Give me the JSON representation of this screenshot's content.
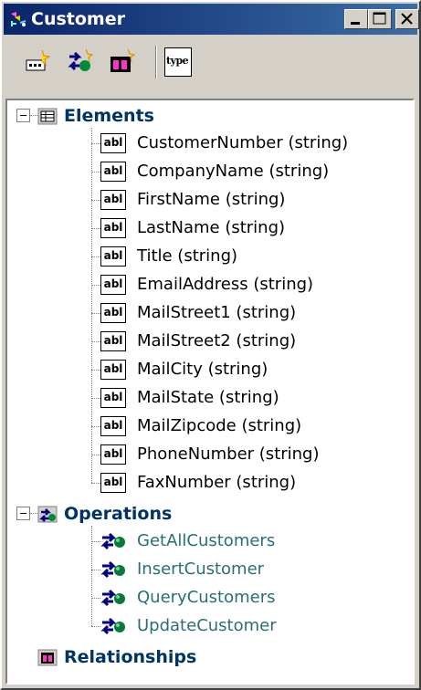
{
  "window": {
    "title": "Customer",
    "controls": [
      "minimize",
      "maximize",
      "close"
    ]
  },
  "toolbar": {
    "buttons": [
      {
        "icon": "add-element-icon"
      },
      {
        "icon": "add-operation-icon"
      },
      {
        "icon": "add-relationship-icon"
      },
      {
        "icon": "type-icon",
        "label": "type"
      }
    ]
  },
  "tree": {
    "elements": {
      "label": "Elements",
      "items": [
        {
          "badge": "abl",
          "label": "CustomerNumber (string)"
        },
        {
          "badge": "abl",
          "label": "CompanyName (string)"
        },
        {
          "badge": "abl",
          "label": "FirstName (string)"
        },
        {
          "badge": "abl",
          "label": "LastName (string)"
        },
        {
          "badge": "abl",
          "label": "Title (string)"
        },
        {
          "badge": "abl",
          "label": "EmailAddress (string)"
        },
        {
          "badge": "abl",
          "label": "MailStreet1 (string)"
        },
        {
          "badge": "abl",
          "label": "MailStreet2 (string)"
        },
        {
          "badge": "abl",
          "label": "MailCity (string)"
        },
        {
          "badge": "abl",
          "label": "MailState (string)"
        },
        {
          "badge": "abl",
          "label": "MailZipcode (string)"
        },
        {
          "badge": "abl",
          "label": "PhoneNumber (string)"
        },
        {
          "badge": "abl",
          "label": "FaxNumber (string)"
        }
      ]
    },
    "operations": {
      "label": "Operations",
      "items": [
        {
          "label": "GetAllCustomers"
        },
        {
          "label": "InsertCustomer"
        },
        {
          "label": "QueryCustomers"
        },
        {
          "label": "UpdateCustomer"
        }
      ]
    },
    "relationships": {
      "label": "Relationships"
    }
  },
  "colors": {
    "titlebar_start": "#0a246a",
    "titlebar_end": "#3a6ea5",
    "group_label": "#003366",
    "operation_label": "#2a6e78"
  }
}
